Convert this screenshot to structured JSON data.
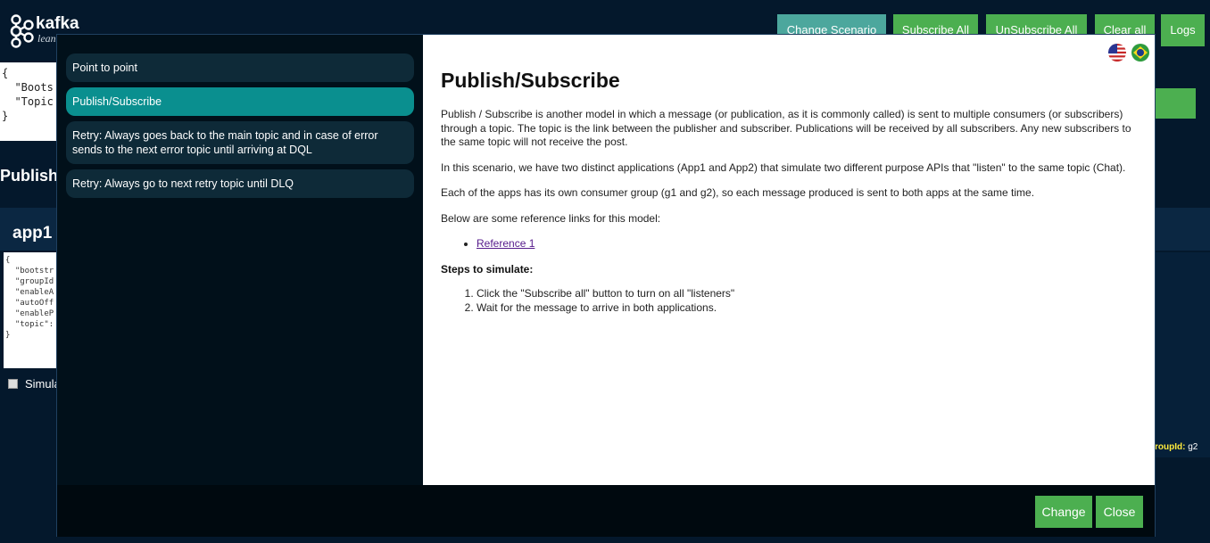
{
  "header": {
    "logo_text": "kafka",
    "logo_sub": "lean",
    "buttons": {
      "change_scenario": "Change Scenario",
      "subscribe_all": "Subscribe All",
      "unsubscribe_all": "UnSubscribe All",
      "clear_all": "Clear all",
      "logs": "Logs"
    }
  },
  "background": {
    "config_text": "{\n  \"Boots\n  \"Topic\n}",
    "section_title": "Publish",
    "app1_title": "app1",
    "app1_config": "{\n  \"bootstr\n  \"groupId\n  \"enableA\n  \"autoOff\n  \"enableP\n  \"topic\":\n}",
    "simulate_label": "Simula",
    "group_label_key": "roupId:",
    "group_label_value": "g2"
  },
  "modal": {
    "scenarios": [
      {
        "label": "Point to point",
        "active": false
      },
      {
        "label": "Publish/Subscribe",
        "active": true
      },
      {
        "label": "Retry: Always goes back to the main topic and in case of error sends to the next error topic until arriving at DQL",
        "active": false
      },
      {
        "label": "Retry: Always go to next retry topic until DLQ",
        "active": false
      }
    ],
    "content": {
      "title": "Publish/Subscribe",
      "paragraphs": [
        "Publish / Subscribe is another model in which a message (or publication, as it is commonly called) is sent to multiple consumers (or subscribers) through a topic. The topic is the link between the publisher and subscriber. Publications will be received by all subscribers. Any new subscribers to the same topic will not receive the post.",
        "In this scenario, we have two distinct applications (App1 and App2) that simulate two different purpose APIs that \"listen\" to the same topic (Chat).",
        "Each of the apps has its own consumer group (g1 and g2), so each message produced is sent to both apps at the same time.",
        "Below are some reference links for this model:"
      ],
      "reference_link": "Reference 1",
      "steps_title": "Steps to simulate:",
      "steps": [
        "Click the \"Subscribe all\" button to turn on all \"listeners\"",
        "Wait for the message to arrive in both applications."
      ],
      "flags": [
        "us-flag-icon",
        "brazil-flag-icon"
      ]
    },
    "footer": {
      "change": "Change",
      "close": "Close"
    }
  }
}
